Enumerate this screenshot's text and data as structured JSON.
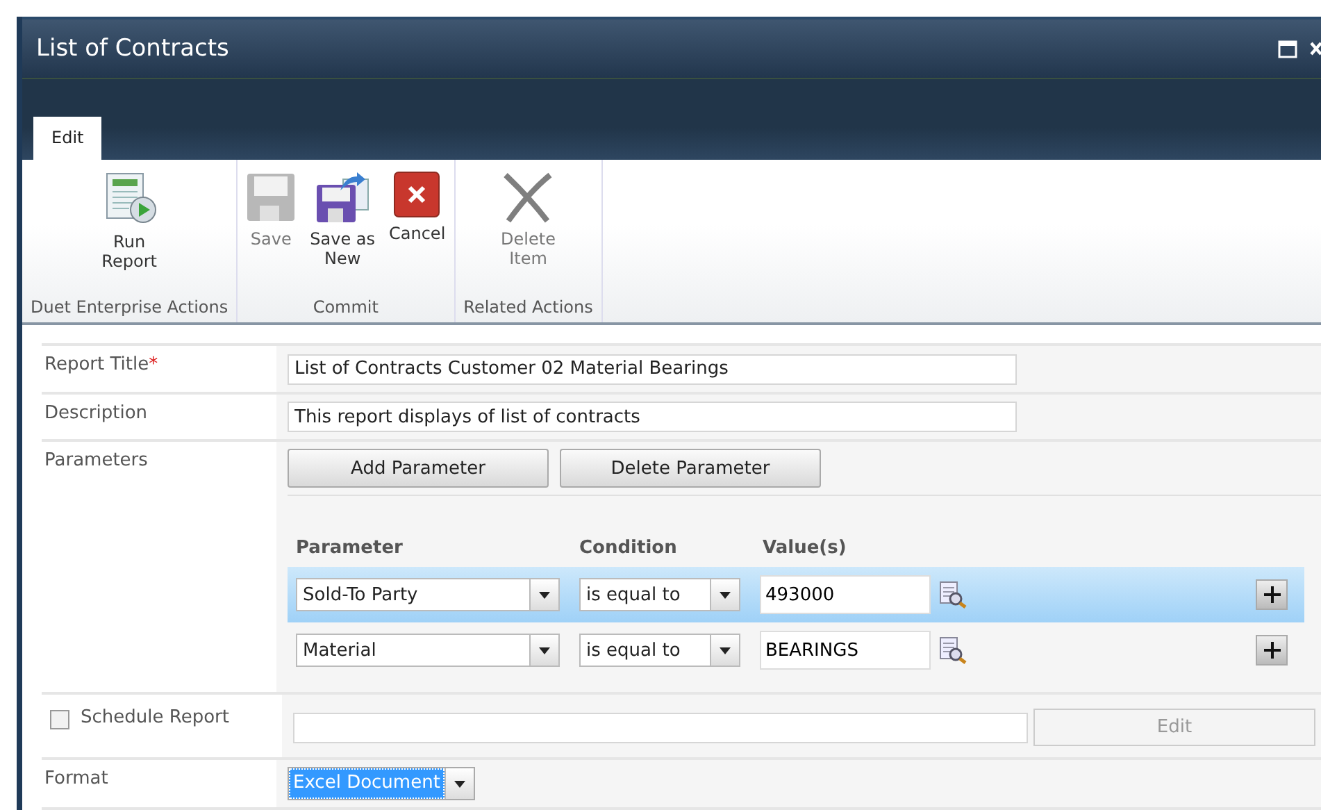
{
  "window": {
    "title": "List of Contracts"
  },
  "tabs": [
    {
      "label": "Edit",
      "selected": true
    }
  ],
  "ribbon_groups": [
    {
      "label": "Duet Enterprise Actions",
      "buttons": [
        {
          "kind": "run",
          "label": "Run Report",
          "disabled": false
        }
      ]
    },
    {
      "label": "Commit",
      "buttons": [
        {
          "kind": "save",
          "label": "Save",
          "disabled": true
        },
        {
          "kind": "saveas",
          "label": "Save as New",
          "disabled": false
        },
        {
          "kind": "cancel",
          "label": "Cancel",
          "disabled": false
        }
      ]
    },
    {
      "label": "Related Actions",
      "buttons": [
        {
          "kind": "delete",
          "label": "Delete Item",
          "disabled": true
        }
      ]
    }
  ],
  "form": {
    "report_title": {
      "label": "Report Title",
      "required_mark": "*",
      "value": "List of Contracts Customer 02 Material Bearings"
    },
    "description": {
      "label": "Description",
      "value": "This report displays of list of contracts"
    },
    "parameters": {
      "label": "Parameters",
      "add_button": "Add Parameter",
      "delete_button": "Delete Parameter",
      "columns": [
        "Parameter",
        "Condition",
        "Value(s)"
      ],
      "rows": [
        {
          "parameter": "Sold-To Party",
          "condition": "is equal to",
          "value": "493000",
          "selected": true
        },
        {
          "parameter": "Material",
          "condition": "is equal to",
          "value": "BEARINGS",
          "selected": false
        }
      ]
    },
    "schedule": {
      "label": "Schedule Report",
      "checked": false,
      "edit_button": "Edit",
      "edit_disabled": true
    },
    "format": {
      "label": "Format",
      "value": "Excel Document"
    }
  }
}
